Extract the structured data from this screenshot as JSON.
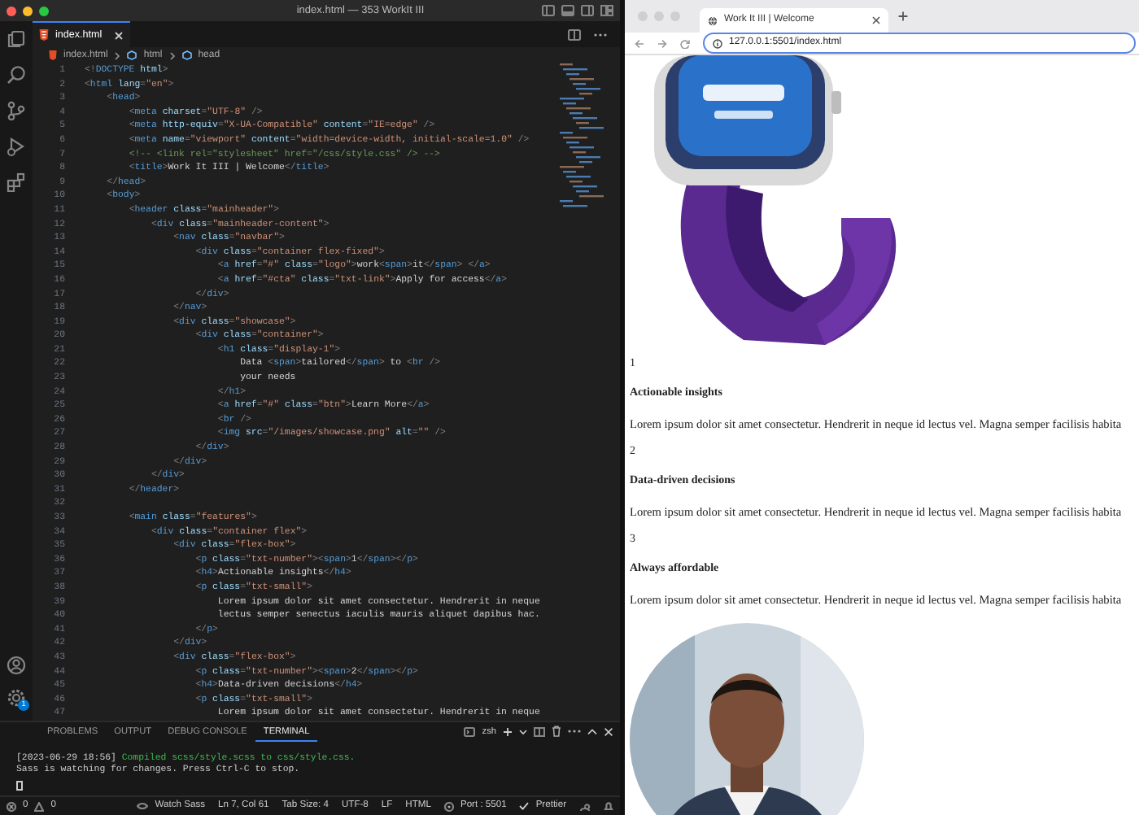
{
  "editor_window": {
    "title": "index.html — 353 WorkIt III"
  },
  "activity_bar": {
    "badge": "1"
  },
  "editor_tab": {
    "label": "index.html"
  },
  "breadcrumbs": [
    "index.html",
    "html",
    "head"
  ],
  "code_lines": [
    {
      "number": "1",
      "text": "<!DOCTYPE html>"
    },
    {
      "number": "2",
      "text": "<html lang=\"en\">"
    },
    {
      "number": "3",
      "text": "    <head>"
    },
    {
      "number": "4",
      "text": "        <meta charset=\"UTF-8\" />"
    },
    {
      "number": "5",
      "text": "        <meta http-equiv=\"X-UA-Compatible\" content=\"IE=edge\" />"
    },
    {
      "number": "6",
      "text": "        <meta name=\"viewport\" content=\"width=device-width, initial-scale=1.0\" />"
    },
    {
      "number": "7",
      "text": "        <!-- <link rel=\"stylesheet\" href=\"/css/style.css\" /> -->"
    },
    {
      "number": "8",
      "text": "        <title>Work It III | Welcome</title>"
    },
    {
      "number": "9",
      "text": "    </head>"
    },
    {
      "number": "10",
      "text": "    <body>"
    },
    {
      "number": "11",
      "text": "        <header class=\"mainheader\">"
    },
    {
      "number": "12",
      "text": "            <div class=\"mainheader-content\">"
    },
    {
      "number": "13",
      "text": "                <nav class=\"navbar\">"
    },
    {
      "number": "14",
      "text": "                    <div class=\"container flex-fixed\">"
    },
    {
      "number": "15",
      "text": "                        <a href=\"#\" class=\"logo\">work<span>it</span> </a>"
    },
    {
      "number": "16",
      "text": "                        <a href=\"#cta\" class=\"txt-link\">Apply for access</a>"
    },
    {
      "number": "17",
      "text": "                    </div>"
    },
    {
      "number": "18",
      "text": "                </nav>"
    },
    {
      "number": "19",
      "text": "                <div class=\"showcase\">"
    },
    {
      "number": "20",
      "text": "                    <div class=\"container\">"
    },
    {
      "number": "21",
      "text": "                        <h1 class=\"display-1\">"
    },
    {
      "number": "22",
      "text": "                            Data <span>tailored</span> to <br />"
    },
    {
      "number": "23",
      "text": "                            your needs"
    },
    {
      "number": "24",
      "text": "                        </h1>"
    },
    {
      "number": "25",
      "text": "                        <a href=\"#\" class=\"btn\">Learn More</a>"
    },
    {
      "number": "26",
      "text": "                        <br />"
    },
    {
      "number": "27",
      "text": "                        <img src=\"/images/showcase.png\" alt=\"\" />"
    },
    {
      "number": "28",
      "text": "                    </div>"
    },
    {
      "number": "29",
      "text": "                </div>"
    },
    {
      "number": "30",
      "text": "            </div>"
    },
    {
      "number": "31",
      "text": "        </header>"
    },
    {
      "number": "32"
    },
    {
      "number": "33",
      "text": "        <main class=\"features\">"
    },
    {
      "number": "34",
      "text": "            <div class=\"container flex\">"
    },
    {
      "number": "35",
      "text": "                <div class=\"flex-box\">"
    },
    {
      "number": "36",
      "text": "                    <p class=\"txt-number\"><span>1</span></p>"
    },
    {
      "number": "37",
      "text": "                    <h4>Actionable insights</h4>"
    },
    {
      "number": "38",
      "text": "                    <p class=\"txt-small\">"
    },
    {
      "number": "39",
      "text": "                        Lorem ipsum dolor sit amet consectetur. Hendrerit in neque"
    },
    {
      "number": "40",
      "text": "                        lectus semper senectus iaculis mauris aliquet dapibus hac."
    },
    {
      "number": "41",
      "text": "                    </p>"
    },
    {
      "number": "42",
      "text": "                </div>"
    },
    {
      "number": "43",
      "text": "                <div class=\"flex-box\">"
    },
    {
      "number": "44",
      "text": "                    <p class=\"txt-number\"><span>2</span></p>"
    },
    {
      "number": "45",
      "text": "                    <h4>Data-driven decisions</h4>"
    },
    {
      "number": "46",
      "text": "                    <p class=\"txt-small\">"
    },
    {
      "number": "47",
      "text": "                        Lorem ipsum dolor sit amet consectetur. Hendrerit in neque"
    }
  ],
  "panel": {
    "tabs": [
      {
        "label": "PROBLEMS",
        "selected": false
      },
      {
        "label": "OUTPUT",
        "selected": false
      },
      {
        "label": "DEBUG CONSOLE",
        "selected": false
      },
      {
        "label": "TERMINAL",
        "selected": true
      }
    ],
    "shell": "zsh",
    "terminal": {
      "timestamp": "[2023-06-29 18:56]",
      "message": "Compiled scss/style.scss to css/style.css.",
      "line_2": "Sass is watching for changes. Press Ctrl-C to stop."
    }
  },
  "status_bar": {
    "errors": "0",
    "warnings": "0",
    "items": [
      {
        "kind": "watch",
        "text": "Watch Sass"
      },
      {
        "kind": "plain",
        "text": "Ln 7, Col 61"
      },
      {
        "kind": "plain",
        "text": "Tab Size: 4"
      },
      {
        "kind": "plain",
        "text": "UTF-8"
      },
      {
        "kind": "plain",
        "text": "LF"
      },
      {
        "kind": "plain",
        "text": "HTML"
      },
      {
        "kind": "port",
        "text": "Port : 5501"
      },
      {
        "kind": "check",
        "text": "Prettier"
      }
    ]
  },
  "browser": {
    "tab_title": "Work It III | Welcome",
    "url": "127.0.0.1:5501/index.html",
    "features": [
      {
        "number": "1",
        "title": "Actionable insights",
        "text": "Lorem ipsum dolor sit amet consectetur. Hendrerit in neque id lectus vel. Magna semper facilisis habita"
      },
      {
        "number": "2",
        "title": "Data-driven decisions",
        "text": "Lorem ipsum dolor sit amet consectetur. Hendrerit in neque id lectus vel. Magna semper facilisis habita"
      },
      {
        "number": "3",
        "title": "Always affordable",
        "text": "Lorem ipsum dolor sit amet consectetur. Hendrerit in neque id lectus vel. Magna semper facilisis habita"
      }
    ]
  }
}
